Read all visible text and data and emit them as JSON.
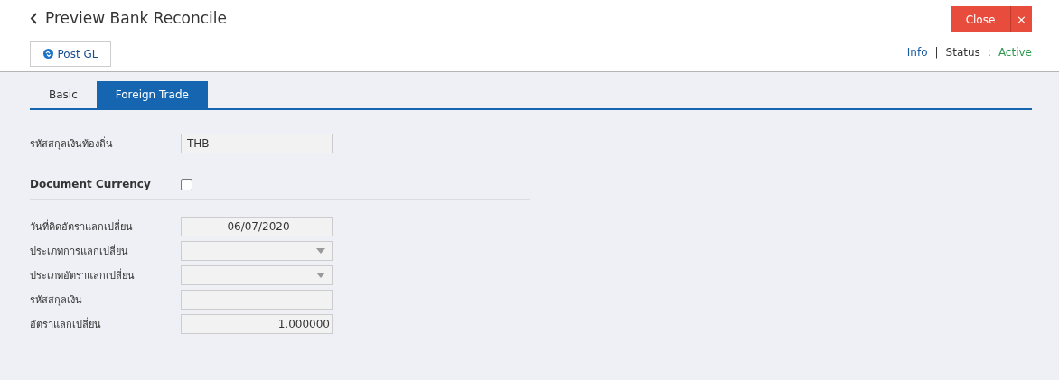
{
  "header": {
    "title": "Preview Bank Reconcile",
    "close_label": "Close",
    "close_icon": "×",
    "post_label": "Post GL",
    "info_link": "Info",
    "separator": "|",
    "status_label": "Status",
    "status_colon": ":",
    "status_value": "Active"
  },
  "tabs": [
    {
      "label": "Basic",
      "selected": false
    },
    {
      "label": "Foreign Trade",
      "selected": true
    }
  ],
  "local_currency": {
    "label": "รหัสสกุลเงินท้องถิ่น",
    "kind": "text",
    "value": "THB"
  },
  "document_currency": {
    "label": "Document Currency",
    "checked": false
  },
  "fields": [
    {
      "label": "วันที่คิดอัตราแลกเปลี่ยน",
      "kind": "date",
      "value": "06/07/2020"
    },
    {
      "label": "ประเภทการแลกเปลี่ยน",
      "kind": "select"
    },
    {
      "label": "ประเภทอัตราแลกเปลี่ยน",
      "kind": "select"
    },
    {
      "label": "รหัสสกุลเงิน",
      "kind": "text"
    },
    {
      "label": "อัตราแลกเปลี่ยน",
      "kind": "number",
      "value": "1.000000"
    }
  ]
}
